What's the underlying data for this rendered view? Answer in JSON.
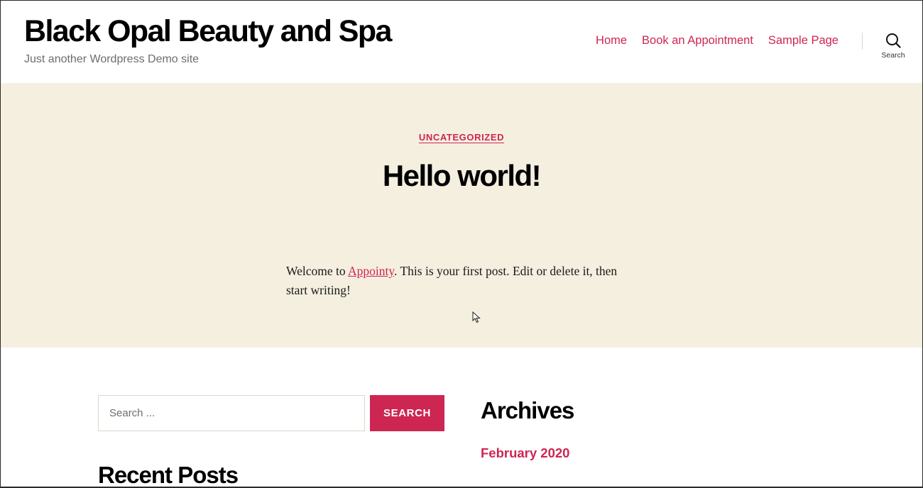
{
  "header": {
    "site_title": "Black Opal Beauty and Spa",
    "site_description": "Just another Wordpress Demo site",
    "nav": [
      {
        "label": "Home"
      },
      {
        "label": "Book an Appointment"
      },
      {
        "label": "Sample Page"
      }
    ],
    "search_label": "Search"
  },
  "post": {
    "category": "UNCATEGORIZED",
    "title": "Hello world!",
    "content_before": "Welcome to ",
    "content_link": "Appointy",
    "content_after": ". This is your first post. Edit or delete it, then start writing!"
  },
  "widgets": {
    "search_placeholder": "Search ...",
    "search_button": "SEARCH",
    "recent_posts_title": "Recent Posts",
    "archives_title": "Archives",
    "archive_items": [
      {
        "label": "February 2020"
      }
    ]
  },
  "colors": {
    "accent": "#cd2653",
    "hero_background": "#f5efe0",
    "text": "#000000",
    "muted": "#6d6d6d"
  },
  "icons": {
    "search": "search-icon",
    "cursor": "mouse-cursor-icon"
  }
}
